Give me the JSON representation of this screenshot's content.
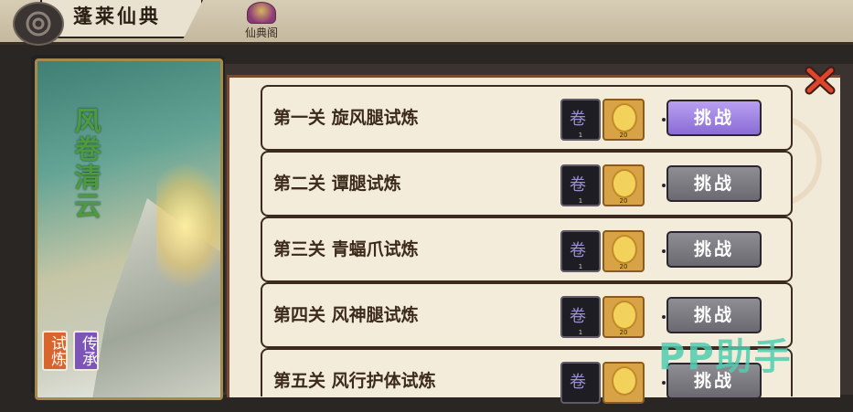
{
  "header": {
    "title": "蓬莱仙典",
    "nav_label": "仙典阁"
  },
  "card": {
    "title": "风卷清云",
    "tabs": [
      "试炼",
      "传承"
    ]
  },
  "levels": [
    {
      "name": "第一关 旋风腿试炼",
      "reward_book_count": "1",
      "reward_coin_count": "20",
      "button": "挑战",
      "state": "active"
    },
    {
      "name": "第二关 谭腿试炼",
      "reward_book_count": "1",
      "reward_coin_count": "20",
      "button": "挑战",
      "state": "locked"
    },
    {
      "name": "第三关 青蝠爪试炼",
      "reward_book_count": "1",
      "reward_coin_count": "20",
      "button": "挑战",
      "state": "locked"
    },
    {
      "name": "第四关 风神腿试炼",
      "reward_book_count": "1",
      "reward_coin_count": "20",
      "button": "挑战",
      "state": "locked"
    },
    {
      "name": "第五关 风行护体试炼",
      "reward_book_count": "",
      "reward_coin_count": "",
      "button": "挑战",
      "state": "locked"
    }
  ],
  "watermark": "PP助手",
  "colors": {
    "active_button": "#9b80e0",
    "locked_button": "#7d7c83",
    "trial_tab": "#d8642e",
    "legacy_tab": "#7d55b8",
    "card_title": "#4d9a3f"
  },
  "icons": {
    "back": "spiral-emblem-icon",
    "close": "red-x-icon",
    "book": "skill-book-icon",
    "coin": "gold-coin-icon"
  }
}
